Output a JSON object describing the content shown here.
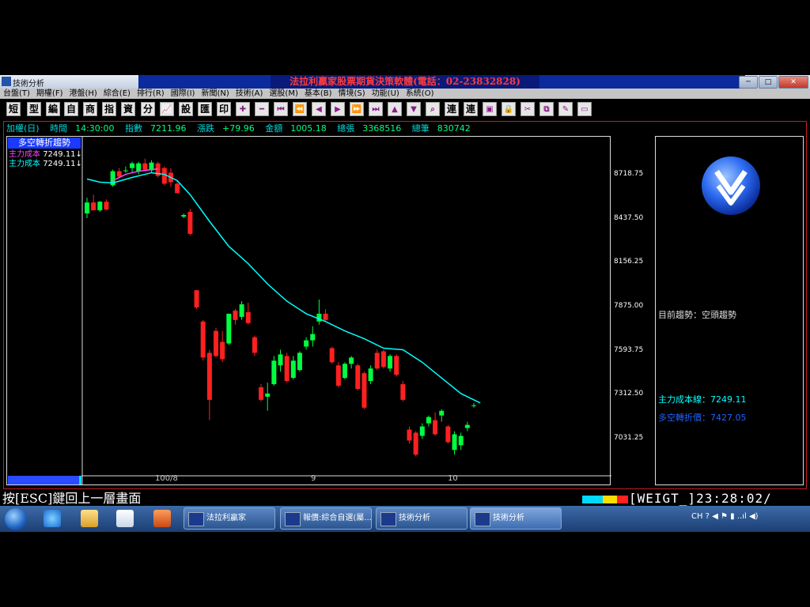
{
  "window": {
    "title": "技術分析",
    "banner": "法拉利贏家股票期貨決策軟體(電話：02-23832828)",
    "controls": [
      "─",
      "□",
      "✕"
    ]
  },
  "menu": [
    "台盤(T)",
    "期權(F)",
    "港盤(H)",
    "綜合(E)",
    "排行(R)",
    "國際(I)",
    "新聞(N)",
    "技術(A)",
    "選股(M)",
    "基本(B)",
    "情境(S)",
    "功能(U)",
    "系統(O)"
  ],
  "toolbar": {
    "text_buttons": [
      "短",
      "型",
      "編",
      "自",
      "商",
      "指",
      "資",
      "分"
    ],
    "text_buttons2": [
      "設",
      "匯",
      "印"
    ],
    "text_buttons3": [
      "連",
      "連"
    ]
  },
  "infobar": {
    "symbol": "加權(日)",
    "time_label": "時間",
    "time_value": "14:30:00",
    "index_label": "指數",
    "index_value": "7211.96",
    "change_label": "漲跌",
    "change_value": "+79.96",
    "amount_label": "金額",
    "amount_value": "1005.18",
    "volume_label": "總張",
    "volume_value": "3368516",
    "trades_label": "總筆",
    "trades_value": "830742"
  },
  "indicator": {
    "title": "多空轉折趨勢",
    "legend1_label": "主力成本",
    "legend1_value": "7249.11↓",
    "legend2_label": "主力成本",
    "legend2_value": "7249.11↓",
    "legend1_color": "#ff44ff",
    "legend2_color": "#00ffff"
  },
  "chart_data": {
    "type": "candlestick",
    "y_ticks": [
      "8718.75",
      "8437.50",
      "8156.25",
      "7875.00",
      "7593.75",
      "7312.50",
      "7031.25"
    ],
    "ylim": [
      6800,
      8960
    ],
    "x_labels": [
      "100/8",
      "9",
      "10"
    ],
    "up_color": "#00ff40",
    "down_color": "#ff2020",
    "candles": [
      {
        "o": 8470,
        "h": 8570,
        "l": 8440,
        "c": 8540
      },
      {
        "o": 8540,
        "h": 8590,
        "l": 8490,
        "c": 8490
      },
      {
        "o": 8490,
        "h": 8550,
        "l": 8480,
        "c": 8545
      },
      {
        "o": 8545,
        "h": 8560,
        "l": 8490,
        "c": 8495
      },
      {
        "o": 8650,
        "h": 8750,
        "l": 8640,
        "c": 8740
      },
      {
        "o": 8740,
        "h": 8760,
        "l": 8700,
        "c": 8705
      },
      {
        "o": 8740,
        "h": 8770,
        "l": 8730,
        "c": 8745
      },
      {
        "o": 8760,
        "h": 8800,
        "l": 8730,
        "c": 8790
      },
      {
        "o": 8740,
        "h": 8800,
        "l": 8720,
        "c": 8790
      },
      {
        "o": 8790,
        "h": 8820,
        "l": 8740,
        "c": 8750
      },
      {
        "o": 8745,
        "h": 8810,
        "l": 8730,
        "c": 8795
      },
      {
        "o": 8790,
        "h": 8800,
        "l": 8700,
        "c": 8710
      },
      {
        "o": 8760,
        "h": 8770,
        "l": 8650,
        "c": 8660
      },
      {
        "o": 8730,
        "h": 8760,
        "l": 8640,
        "c": 8670
      },
      {
        "o": 8660,
        "h": 8680,
        "l": 8600,
        "c": 8600
      },
      {
        "o": 8450,
        "h": 8470,
        "l": 8440,
        "c": 8460
      },
      {
        "o": 8480,
        "h": 8500,
        "l": 8330,
        "c": 8340
      },
      {
        "o": 7980,
        "h": 7980,
        "l": 7860,
        "c": 7870
      },
      {
        "o": 7780,
        "h": 7790,
        "l": 7530,
        "c": 7550
      },
      {
        "o": 7580,
        "h": 7600,
        "l": 7150,
        "c": 7280
      },
      {
        "o": 7720,
        "h": 7740,
        "l": 7550,
        "c": 7560
      },
      {
        "o": 7650,
        "h": 7720,
        "l": 7520,
        "c": 7540
      },
      {
        "o": 7640,
        "h": 7830,
        "l": 7630,
        "c": 7830
      },
      {
        "o": 7850,
        "h": 7860,
        "l": 7760,
        "c": 7790
      },
      {
        "o": 7810,
        "h": 7910,
        "l": 7790,
        "c": 7890
      },
      {
        "o": 7840,
        "h": 7900,
        "l": 7760,
        "c": 7770
      },
      {
        "o": 7680,
        "h": 7690,
        "l": 7560,
        "c": 7580
      },
      {
        "o": 7360,
        "h": 7380,
        "l": 7270,
        "c": 7280
      },
      {
        "o": 7300,
        "h": 7390,
        "l": 7210,
        "c": 7320
      },
      {
        "o": 7380,
        "h": 7560,
        "l": 7370,
        "c": 7530
      },
      {
        "o": 7500,
        "h": 7600,
        "l": 7460,
        "c": 7570
      },
      {
        "o": 7560,
        "h": 7580,
        "l": 7390,
        "c": 7400
      },
      {
        "o": 7420,
        "h": 7560,
        "l": 7410,
        "c": 7530
      },
      {
        "o": 7470,
        "h": 7590,
        "l": 7460,
        "c": 7580
      },
      {
        "o": 7620,
        "h": 7680,
        "l": 7600,
        "c": 7660
      },
      {
        "o": 7660,
        "h": 7750,
        "l": 7620,
        "c": 7700
      },
      {
        "o": 7780,
        "h": 7920,
        "l": 7760,
        "c": 7830
      },
      {
        "o": 7830,
        "h": 7860,
        "l": 7780,
        "c": 7790
      },
      {
        "o": 7610,
        "h": 7620,
        "l": 7510,
        "c": 7520
      },
      {
        "o": 7500,
        "h": 7520,
        "l": 7360,
        "c": 7370
      },
      {
        "o": 7420,
        "h": 7520,
        "l": 7410,
        "c": 7510
      },
      {
        "o": 7510,
        "h": 7560,
        "l": 7480,
        "c": 7550
      },
      {
        "o": 7500,
        "h": 7510,
        "l": 7340,
        "c": 7350
      },
      {
        "o": 7450,
        "h": 7460,
        "l": 7220,
        "c": 7230
      },
      {
        "o": 7400,
        "h": 7500,
        "l": 7380,
        "c": 7480
      },
      {
        "o": 7580,
        "h": 7600,
        "l": 7470,
        "c": 7480
      },
      {
        "o": 7590,
        "h": 7600,
        "l": 7480,
        "c": 7490
      },
      {
        "o": 7480,
        "h": 7570,
        "l": 7460,
        "c": 7560
      },
      {
        "o": 7560,
        "h": 7570,
        "l": 7430,
        "c": 7440
      },
      {
        "o": 7380,
        "h": 7400,
        "l": 7270,
        "c": 7280
      },
      {
        "o": 7090,
        "h": 7110,
        "l": 7000,
        "c": 7020
      },
      {
        "o": 7070,
        "h": 7080,
        "l": 6920,
        "c": 6930
      },
      {
        "o": 7050,
        "h": 7130,
        "l": 7030,
        "c": 7110
      },
      {
        "o": 7130,
        "h": 7180,
        "l": 7110,
        "c": 7170
      },
      {
        "o": 7150,
        "h": 7200,
        "l": 7050,
        "c": 7060
      },
      {
        "o": 7180,
        "h": 7220,
        "l": 7140,
        "c": 7210
      },
      {
        "o": 7110,
        "h": 7120,
        "l": 7000,
        "c": 7010
      },
      {
        "o": 6960,
        "h": 7080,
        "l": 6930,
        "c": 7060
      },
      {
        "o": 6990,
        "h": 7070,
        "l": 6960,
        "c": 7050
      },
      {
        "o": 7100,
        "h": 7140,
        "l": 7080,
        "c": 7120
      },
      {
        "o": 7240,
        "h": 7260,
        "l": 7230,
        "c": 7245
      }
    ],
    "magenta_line": [
      [
        4,
        8680
      ],
      [
        5,
        8700
      ],
      [
        6,
        8720
      ],
      [
        7,
        8730
      ],
      [
        8,
        8740
      ],
      [
        9,
        8745
      ],
      [
        10,
        8750
      ],
      [
        11,
        8755
      ]
    ],
    "cyan_line": [
      [
        0,
        8690
      ],
      [
        2,
        8670
      ],
      [
        4,
        8665
      ],
      [
        7,
        8700
      ],
      [
        10,
        8730
      ],
      [
        12,
        8720
      ],
      [
        14,
        8680
      ],
      [
        16,
        8590
      ],
      [
        19,
        8420
      ],
      [
        22,
        8260
      ],
      [
        25,
        8150
      ],
      [
        28,
        8020
      ],
      [
        31,
        7910
      ],
      [
        34,
        7830
      ],
      [
        37,
        7780
      ],
      [
        40,
        7720
      ],
      [
        43,
        7670
      ],
      [
        46,
        7610
      ],
      [
        49,
        7600
      ],
      [
        52,
        7520
      ],
      [
        55,
        7420
      ],
      [
        58,
        7320
      ],
      [
        61,
        7260
      ]
    ]
  },
  "sidepanel": {
    "trend_label": "目前趨勢：空頭趨勢",
    "cost_line": "主力成本線：7249.11",
    "reversal_price": "多空轉折價：7427.05",
    "trend_color": "#2060ff"
  },
  "statusbar": {
    "hint": "按[ESC]鍵回上一層畫面",
    "clock": "[WEIGT_]23:28:02/"
  },
  "taskbar": {
    "tasks": [
      "法拉利贏家",
      "報價:綜合自選(屬...",
      "技術分析",
      "技術分析"
    ],
    "tray": "CH ? ◀ ⚑ ▮ ..ıl ◀)"
  }
}
